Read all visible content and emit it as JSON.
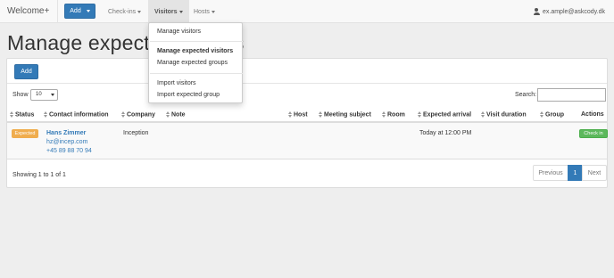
{
  "navbar": {
    "brand": "Welcome+",
    "add_label": "Add",
    "items": [
      {
        "label": "Check-ins"
      },
      {
        "label": "Visitors"
      },
      {
        "label": "Hosts"
      }
    ],
    "user_email": "ex.ample@askcody.dk"
  },
  "page": {
    "title": "Manage expected visitors"
  },
  "panel": {
    "add_label": "Add",
    "show_label": "Show",
    "page_size": "10",
    "search_label": "Search:",
    "search_value": ""
  },
  "table": {
    "columns": [
      "Status",
      "Contact information",
      "Company",
      "Note",
      "Host",
      "Meeting subject",
      "Room",
      "Expected arrival",
      "Visit duration",
      "Group",
      "Actions"
    ],
    "rows": [
      {
        "status": "Expected",
        "name": "Hans Zimmer",
        "email": "hz@incep.com",
        "phone": "+45 89 88 70 94",
        "company": "Inception",
        "note": "",
        "host": "",
        "meeting_subject": "",
        "room": "",
        "expected_arrival": "Today at 12:00 PM",
        "visit_duration": "",
        "group": "",
        "action": "Check in"
      }
    ]
  },
  "footer": {
    "info": "Showing 1 to 1 of 1",
    "previous": "Previous",
    "current_page": "1",
    "next": "Next"
  },
  "dropdown": {
    "items": [
      {
        "label": "Manage visitors"
      },
      {
        "label": "Manage expected visitors"
      },
      {
        "label": "Manage expected groups"
      },
      {
        "label": "Import visitors"
      },
      {
        "label": "Import expected group"
      }
    ]
  },
  "colors": {
    "primary": "#337ab7",
    "success": "#5cb85c",
    "warning": "#f0ad4e"
  }
}
